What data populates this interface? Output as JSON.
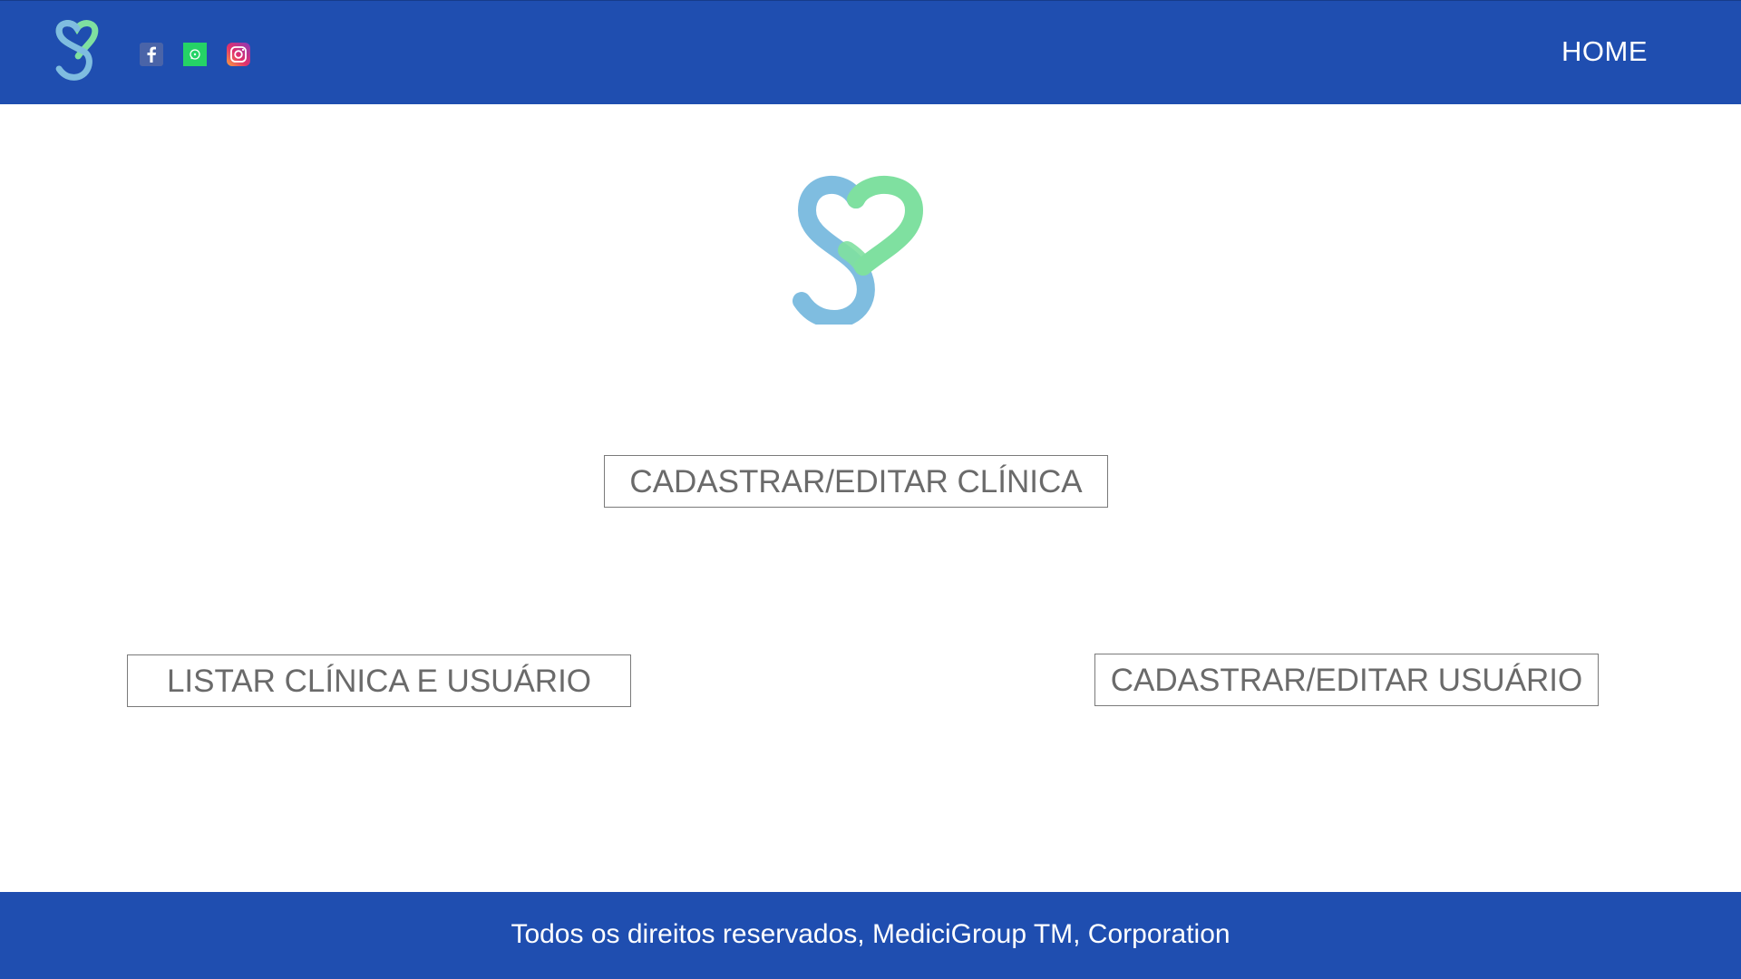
{
  "header": {
    "nav_home_label": "HOME",
    "social": [
      {
        "icon": "facebook-icon",
        "color": "#3b5998"
      },
      {
        "icon": "whatsapp-icon",
        "color": "#25d366"
      },
      {
        "icon": "instagram-icon",
        "color": "#e1306c"
      }
    ],
    "brand_color": "#1f4eb0"
  },
  "logo": {
    "colors": {
      "blue": "#7fbde0",
      "green": "#7fe0a0"
    }
  },
  "actions": {
    "cadastrar_clinica": "CADASTRAR/EDITAR CLÍNICA",
    "listar": "LISTAR CLÍNICA E USUÁRIO",
    "cadastrar_usuario": "CADASTRAR/EDITAR USUÁRIO"
  },
  "footer": {
    "text": "Todos os direitos reservados, MediciGroup TM, Corporation"
  }
}
